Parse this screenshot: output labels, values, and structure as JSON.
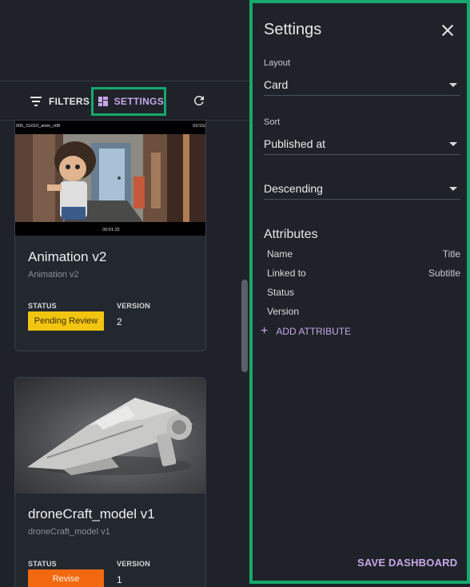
{
  "toolbar": {
    "filters_label": "FILTERS",
    "settings_label": "SETTINGS"
  },
  "cards": [
    {
      "thumb_caption_left": "005_S1010_anim_v08",
      "thumb_caption_right": "02/152",
      "thumb_timecode": "00:01:22",
      "title": "Animation v2",
      "subtitle": "Animation v2",
      "status_label": "STATUS",
      "status": "Pending Review",
      "status_color": "#f2c511",
      "version_label": "VERSION",
      "version": "2"
    },
    {
      "title": "droneCraft_model v1",
      "subtitle": "droneCraft_model v1",
      "status_label": "STATUS",
      "status": "Revise",
      "status_color": "#f2690f",
      "version_label": "VERSION",
      "version": "1"
    }
  ],
  "settings": {
    "title": "Settings",
    "layout_label": "Layout",
    "layout_value": "Card",
    "sort_label": "Sort",
    "sort_value": "Published at",
    "order_value": "Descending",
    "attributes_heading": "Attributes",
    "attributes": [
      {
        "name": "Name",
        "role": "Title"
      },
      {
        "name": "Linked to",
        "role": "Subtitle"
      },
      {
        "name": "Status",
        "role": ""
      },
      {
        "name": "Version",
        "role": ""
      }
    ],
    "add_attribute_label": "ADD ATTRIBUTE",
    "save_label": "SAVE DASHBOARD"
  },
  "colors": {
    "accent": "#c7a6e8",
    "highlight_border": "#16a86c"
  }
}
